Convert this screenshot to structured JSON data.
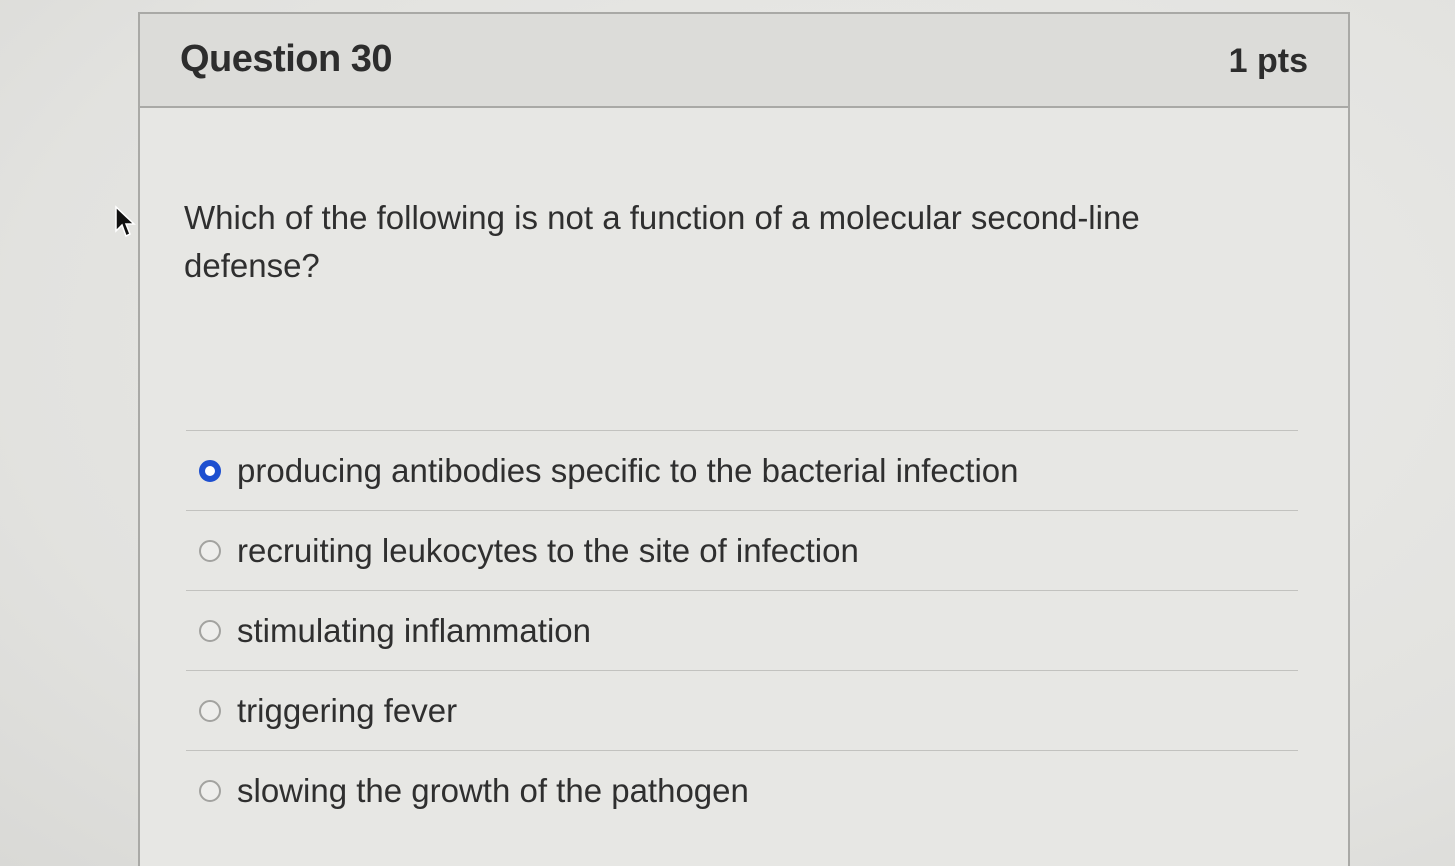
{
  "question": {
    "title": "Question 30",
    "points": "1 pts",
    "text": "Which of the following is not a function of a molecular second-line defense?",
    "answers": [
      {
        "label": "producing antibodies specific to the bacterial infection",
        "selected": true
      },
      {
        "label": "recruiting leukocytes to the site of infection",
        "selected": false
      },
      {
        "label": "stimulating inflammation",
        "selected": false
      },
      {
        "label": "triggering fever",
        "selected": false
      },
      {
        "label": "slowing the growth of the pathogen",
        "selected": false
      }
    ]
  },
  "colors": {
    "selected_radio": "#1d4fd0",
    "text": "#2f2f2f",
    "header_bg": "#dcdcd9"
  },
  "icons": {
    "cursor": "mouse-pointer-icon"
  }
}
